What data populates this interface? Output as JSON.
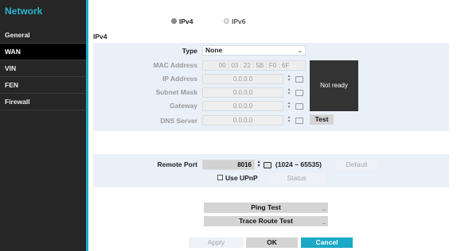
{
  "sidebar": {
    "title": "Network",
    "items": [
      {
        "label": "General"
      },
      {
        "label": "WAN"
      },
      {
        "label": "VIN"
      },
      {
        "label": "FEN"
      },
      {
        "label": "Firewall"
      }
    ]
  },
  "ip_version": {
    "options": [
      {
        "label": "IPv4",
        "selected": true
      },
      {
        "label": "IPv6",
        "selected": false
      }
    ]
  },
  "section_title": "IPv4",
  "ipv4": {
    "type_label": "Type",
    "type_value": "None",
    "mac_label": "MAC Address",
    "mac_value": "00 : 03 : 22 : 5B : F0 : 6F",
    "ip_label": "IP Address",
    "ip_value": "0.0.0.0",
    "subnet_label": "Subnet Mask",
    "subnet_value": "0.0.0.0",
    "gateway_label": "Gateway",
    "gateway_value": "0.0.0.0",
    "dns_label": "DNS Server",
    "dns_value": "0.0.0.0",
    "test_label": "Test",
    "status_text": "Not ready"
  },
  "remote": {
    "port_label": "Remote Port",
    "port_value": "8016",
    "range_text": "(1024 ~ 65535)",
    "default_label": "Default",
    "upnp_label": "Use UPnP",
    "status_label": "Status"
  },
  "tests": {
    "ping_label": "Ping Test",
    "trace_label": "Trace Route Test"
  },
  "footer": {
    "apply_label": "Apply",
    "ok_label": "OK",
    "cancel_label": "Cancel"
  },
  "colors": {
    "accent": "#1ba9c6",
    "sidebar_bg": "#262626",
    "panel_bg": "#e9f0f8"
  }
}
